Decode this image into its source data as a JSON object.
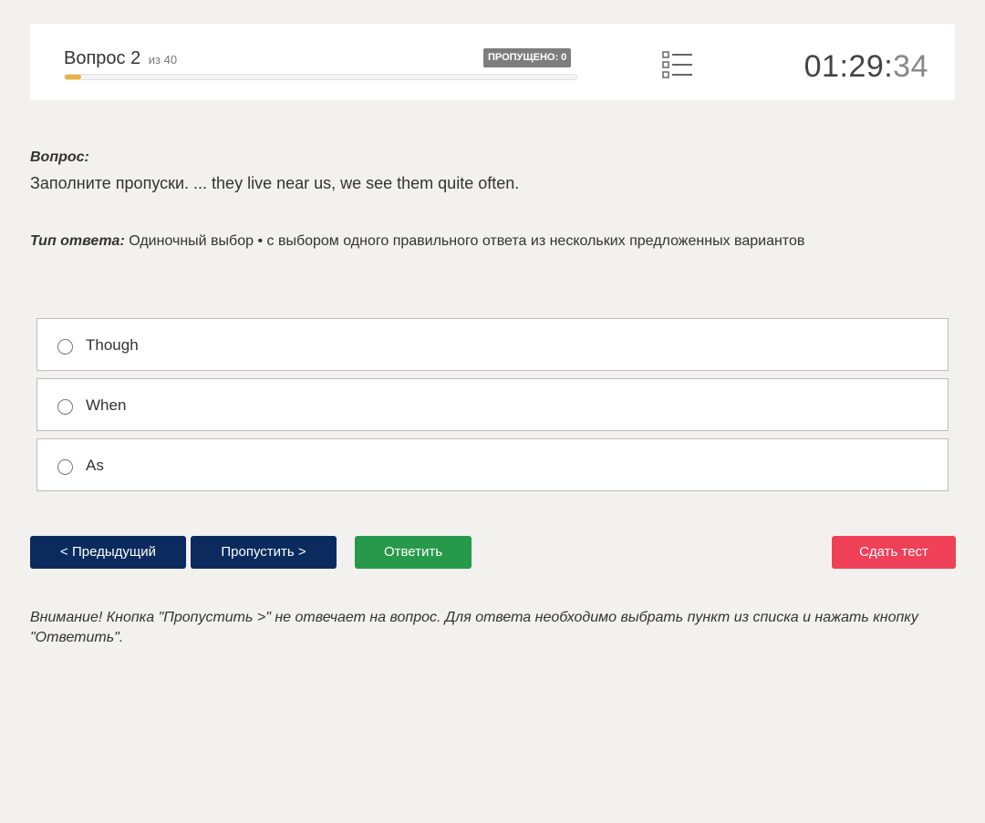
{
  "header": {
    "question_label": "Вопрос 2",
    "question_of": "из 40",
    "skipped_badge": "ПРОПУЩЕНО: 0",
    "progress_fraction": 0.032,
    "list_icon": "list-icon",
    "timer_main": "01:29:",
    "timer_seconds": "34"
  },
  "question": {
    "label": "Вопрос:",
    "text": "Заполните пропуски. ... they live near us, we see them quite often."
  },
  "answer_type": {
    "label": "Тип ответа:",
    "value": "Одиночный выбор • с выбором одного правильного ответа из нескольких предложенных вариантов"
  },
  "options": [
    {
      "label": "Though"
    },
    {
      "label": "When"
    },
    {
      "label": "As"
    }
  ],
  "buttons": {
    "prev": "< Предыдущий",
    "skip": "Пропустить >",
    "answer": "Ответить",
    "submit": "Сдать тест"
  },
  "colors": {
    "accent_progress": "#f0b13b",
    "nav_button": "#0b2b5e",
    "answer_button": "#27994b",
    "submit_button": "#ef4057"
  },
  "notice": "Внимание! Кнопка \"Пропустить >\" не отвечает на вопрос. Для ответа необходимо выбрать пункт из списка и нажать кнопку \"Ответить\"."
}
